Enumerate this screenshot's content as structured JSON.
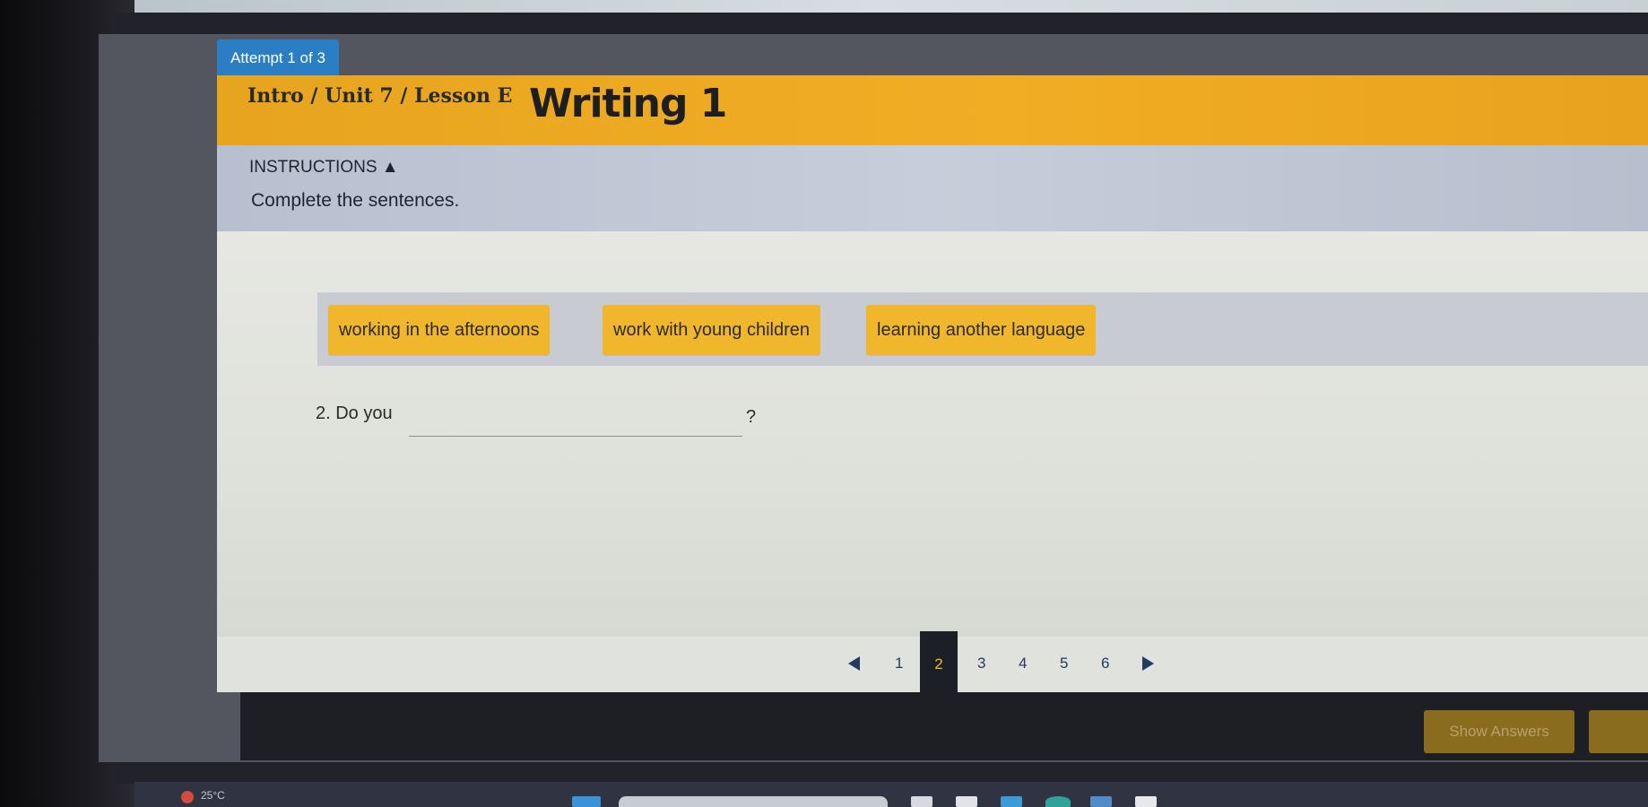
{
  "attempt": {
    "label": "Attempt 1 of 3"
  },
  "header": {
    "breadcrumb": "Intro / Unit 7 / Lesson E",
    "title": "Writing 1"
  },
  "instructions": {
    "toggle_label": "INSTRUCTIONS ▲",
    "text": "Complete the sentences."
  },
  "word_bank": {
    "items": [
      {
        "label": "working in the afternoons"
      },
      {
        "label": "work with young children"
      },
      {
        "label": "learning another language"
      }
    ]
  },
  "question": {
    "prefix": "2. Do you",
    "suffix": "?"
  },
  "pager": {
    "pages": [
      "1",
      "2",
      "3",
      "4",
      "5",
      "6"
    ],
    "current": "2"
  },
  "footer": {
    "show_answers_label": "Show Answers"
  },
  "taskbar": {
    "weather": "25°C"
  },
  "colors": {
    "title_bar": "#f1ad24",
    "chip": "#f0b62c",
    "attempt_badge": "#2a7fc4",
    "instructions_bg": "#c6cedb",
    "pager_accent": "#243a5e"
  }
}
